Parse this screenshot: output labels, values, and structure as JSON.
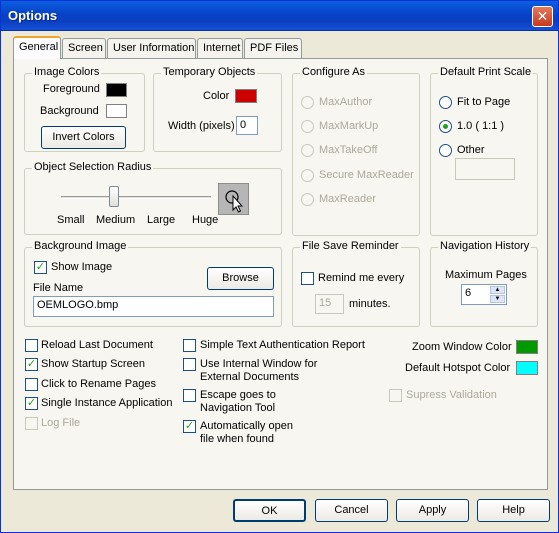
{
  "window": {
    "title": "Options",
    "close_glyph": "✕"
  },
  "tabs": [
    "General",
    "Screen",
    "User Information",
    "Internet",
    "PDF Files"
  ],
  "image_colors": {
    "title": "Image Colors",
    "foreground_label": "Foreground",
    "background_label": "Background",
    "foreground_color": "#000000",
    "background_color": "#ffffff",
    "invert_button": "Invert Colors"
  },
  "temporary_objects": {
    "title": "Temporary Objects",
    "color_label": "Color",
    "color_value": "#cc0000",
    "width_label": "Width (pixels)",
    "width_value": "0"
  },
  "configure_as": {
    "title": "Configure As",
    "options": [
      "MaxAuthor",
      "MaxMarkUp",
      "MaxTakeOff",
      "Secure MaxReader",
      "MaxReader"
    ]
  },
  "default_print_scale": {
    "title": "Default Print Scale",
    "options": [
      "Fit to Page",
      "1.0 ( 1:1 )",
      "Other"
    ],
    "selected": "1.0 ( 1:1 )",
    "other_value": ""
  },
  "selection_radius": {
    "title": "Object Selection Radius",
    "ticks": [
      "Small",
      "Medium",
      "Large",
      "Huge"
    ],
    "selected": "Medium"
  },
  "background_image": {
    "title": "Background Image",
    "show_image_label": "Show Image",
    "show_image_checked": true,
    "browse_button": "Browse",
    "file_name_label": "File Name",
    "file_name_value": "OEMLOGO.bmp"
  },
  "file_save_reminder": {
    "title": "File Save Reminder",
    "remind_label": "Remind me every",
    "remind_checked": false,
    "minutes_value": "15",
    "minutes_label": "minutes."
  },
  "navigation_history": {
    "title": "Navigation History",
    "max_pages_label": "Maximum Pages",
    "max_pages_value": "6"
  },
  "options_col1": [
    {
      "label": "Reload Last Document",
      "checked": false,
      "disabled": false
    },
    {
      "label": "Show Startup Screen",
      "checked": true,
      "disabled": false
    },
    {
      "label": "Click to Rename Pages",
      "checked": false,
      "disabled": false
    },
    {
      "label": "Single Instance Application",
      "checked": true,
      "disabled": false
    },
    {
      "label": "Log File",
      "checked": false,
      "disabled": true
    }
  ],
  "options_col2": [
    {
      "label": "Simple Text Authentication Report",
      "checked": false
    },
    {
      "label": "Use Internal Window for",
      "label2": "External Documents",
      "checked": false
    },
    {
      "label": "Escape goes to",
      "label2": "Navigation Tool",
      "checked": false
    },
    {
      "label": "Automatically open",
      "label2": "file when found",
      "checked": true
    }
  ],
  "zoom_window_color": {
    "label": "Zoom Window Color",
    "color": "#009900"
  },
  "default_hotspot_color": {
    "label": "Default Hotspot Color",
    "color": "#00ffff"
  },
  "supress_validation": {
    "label": "Supress Validation",
    "checked": false
  },
  "buttons": {
    "ok": "OK",
    "cancel": "Cancel",
    "apply": "Apply",
    "help": "Help"
  }
}
